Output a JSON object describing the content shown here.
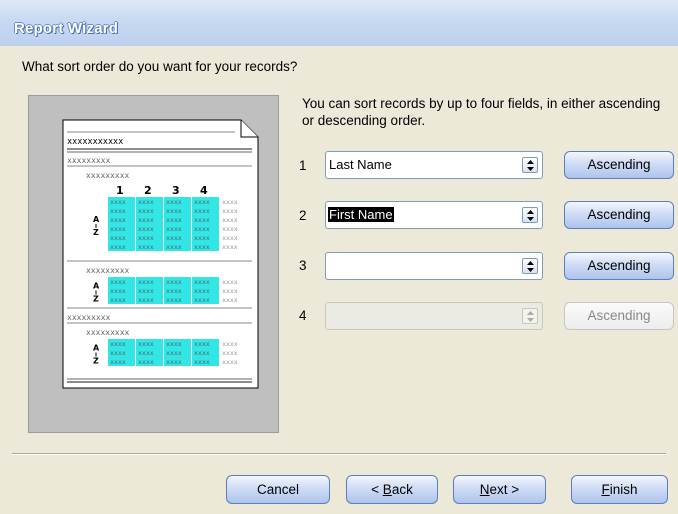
{
  "window": {
    "title": "Report Wizard"
  },
  "question": "What sort order do you want for your records?",
  "instructions": "You can sort records by up to four fields, in either ascending or descending order.",
  "preview": {
    "placeholder_long": "xxxxxxxxxxx",
    "placeholder_medium": "xxxxxxxxx",
    "cell": "xxxx",
    "column_numbers": [
      "1",
      "2",
      "3",
      "4"
    ],
    "sort_glyph_top": "A",
    "sort_glyph_bottom": "Z"
  },
  "sort_rows": [
    {
      "number": "1",
      "field": "Last Name",
      "order": "Ascending",
      "enabled": true,
      "selected": false
    },
    {
      "number": "2",
      "field": "First Name",
      "order": "Ascending",
      "enabled": true,
      "selected": true
    },
    {
      "number": "3",
      "field": "",
      "order": "Ascending",
      "enabled": true,
      "selected": false
    },
    {
      "number": "4",
      "field": "",
      "order": "Ascending",
      "enabled": false,
      "selected": false
    }
  ],
  "buttons": {
    "cancel": "Cancel",
    "back_prefix": "< ",
    "back_mnemonic": "B",
    "back_rest": "ack",
    "next_mnemonic": "N",
    "next_rest": "ext >",
    "finish_mnemonic": "F",
    "finish_rest": "inish"
  },
  "colors": {
    "highlight_cells": "#33e6e6",
    "titlebar": "#bcd0ee"
  }
}
